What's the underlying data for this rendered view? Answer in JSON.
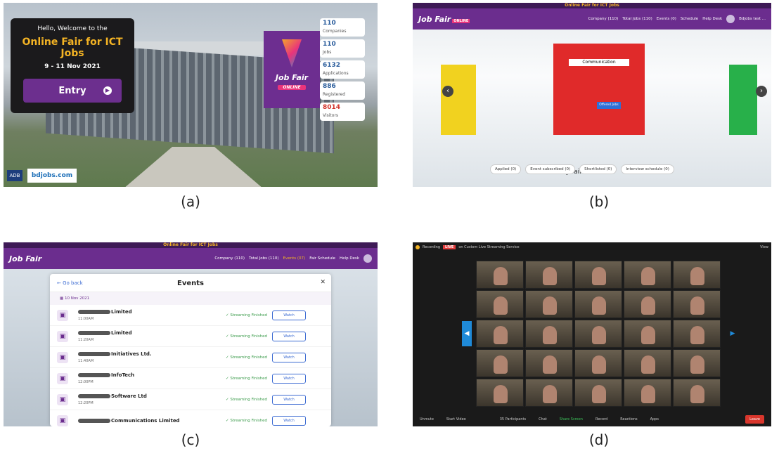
{
  "captions": [
    "(a)",
    "(b)",
    "(c)",
    "(d)"
  ],
  "panel_a": {
    "greeting": "Hello, Welcome to the",
    "title": "Online Fair for ICT Jobs",
    "dates": "9 - 11 Nov 2021",
    "entry_label": "Entry",
    "logo_text": "Job Fair",
    "logo_sub": "ONLINE",
    "stats": [
      {
        "value": "110",
        "label": "Companies"
      },
      {
        "value": "110",
        "label": "Jobs"
      },
      {
        "value": "6132",
        "label": "Applications"
      },
      {
        "value": "886",
        "label": "Registered"
      },
      {
        "value": "8014",
        "label": "Visitors"
      }
    ],
    "adb": "ADB",
    "bdjobs": "bdjobs.com"
  },
  "panel_b": {
    "top_strip": "Online Fair for ICT Jobs",
    "logo": "Job Fair",
    "logo_badge": "ONLINE",
    "nav": [
      "Company (110)",
      "Total Jobs (110)",
      "Events (0)",
      "Schedule",
      "Help Desk"
    ],
    "user": "Bdjobs test ...",
    "booth_name": "Communication",
    "booth_button": "Offered Jobs",
    "my_fair": "My fair activities",
    "activities": [
      "Applied (0)",
      "Event subscribed (0)",
      "Shortlisted (0)",
      "Interview schedule (0)"
    ]
  },
  "panel_c": {
    "top_strip": "Online Fair for ICT Jobs",
    "logo": "Job Fair",
    "nav": [
      "Company (110)",
      "Total Jobs (110)",
      "Events (07)",
      "Fair Schedule",
      "Help Desk"
    ],
    "go_back": "Go back",
    "title": "Events",
    "date": "10 Nov 2021",
    "events": [
      {
        "name": "Limited",
        "time": "11:00AM",
        "status": "Streaming Finished",
        "action": "Watch"
      },
      {
        "name": "Limited",
        "time": "11:20AM",
        "status": "Streaming Finished",
        "action": "Watch"
      },
      {
        "name": "Initiatives Ltd.",
        "time": "11:40AM",
        "status": "Streaming Finished",
        "action": "Watch"
      },
      {
        "name": "InfoTech",
        "time": "12:00PM",
        "status": "Streaming Finished",
        "action": "Watch"
      },
      {
        "name": "Software Ltd",
        "time": "12:20PM",
        "status": "Streaming Finished",
        "action": "Watch"
      },
      {
        "name": "Communications Limited",
        "time": "",
        "status": "Streaming Finished",
        "action": "Watch"
      }
    ]
  },
  "panel_d": {
    "recording": "Recording",
    "live": "LIVE",
    "stream": "on Custom Live Streaming Service",
    "view": "View",
    "toolbar": [
      "Unmute",
      "Start Video",
      "Participants",
      "Chat",
      "Share Screen",
      "Record",
      "Reactions",
      "Apps"
    ],
    "participants_count": "35",
    "leave": "Leave"
  }
}
